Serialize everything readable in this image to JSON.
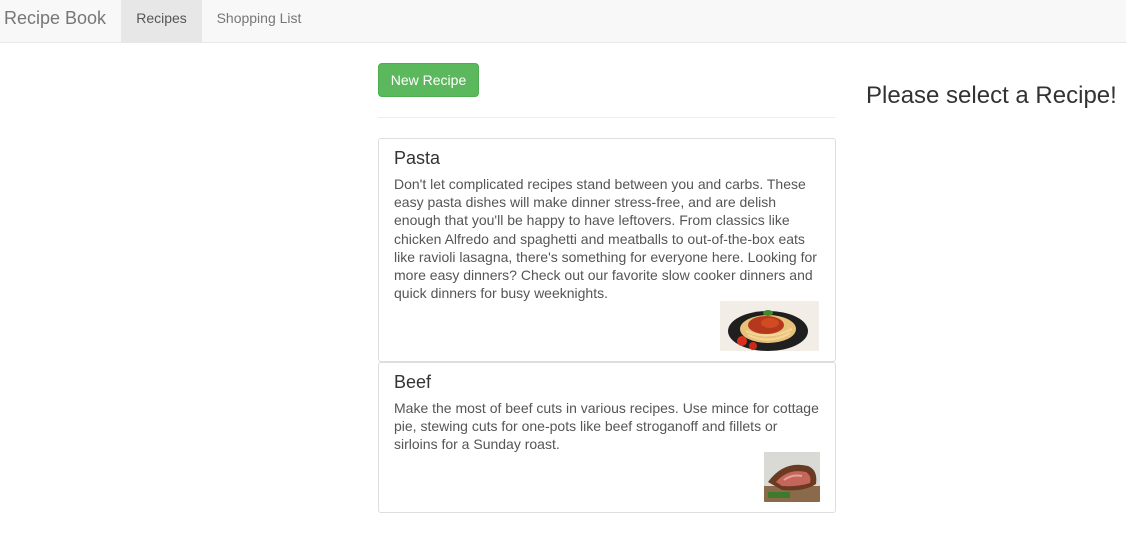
{
  "navbar": {
    "brand": "Recipe Book",
    "tabs": [
      {
        "label": "Recipes",
        "active": true
      },
      {
        "label": "Shopping List",
        "active": false
      }
    ]
  },
  "list": {
    "new_button_label": "New Recipe",
    "recipes": [
      {
        "name": "Pasta",
        "description": "Don't let complicated recipes stand between you and carbs. These easy pasta dishes will make dinner stress-free, and are delish enough that you'll be happy to have leftovers. From classics like chicken Alfredo and spaghetti and meatballs to out-of-the-box eats like ravioli lasagna, there's something for everyone here. Looking for more easy dinners? Check out our favorite slow cooker dinners and quick dinners for busy weeknights.",
        "image": "pasta-dish-photo"
      },
      {
        "name": "Beef",
        "description": "Make the most of beef cuts in various recipes. Use mince for cottage pie, stewing cuts for one-pots like beef stroganoff and fillets or sirloins for a Sunday roast.",
        "image": "beef-roast-photo"
      }
    ]
  },
  "detail": {
    "placeholder": "Please select a Recipe!"
  },
  "colors": {
    "success": "#5cb85c",
    "navbar_bg": "#f8f8f8",
    "active_tab": "#e7e7e7"
  }
}
